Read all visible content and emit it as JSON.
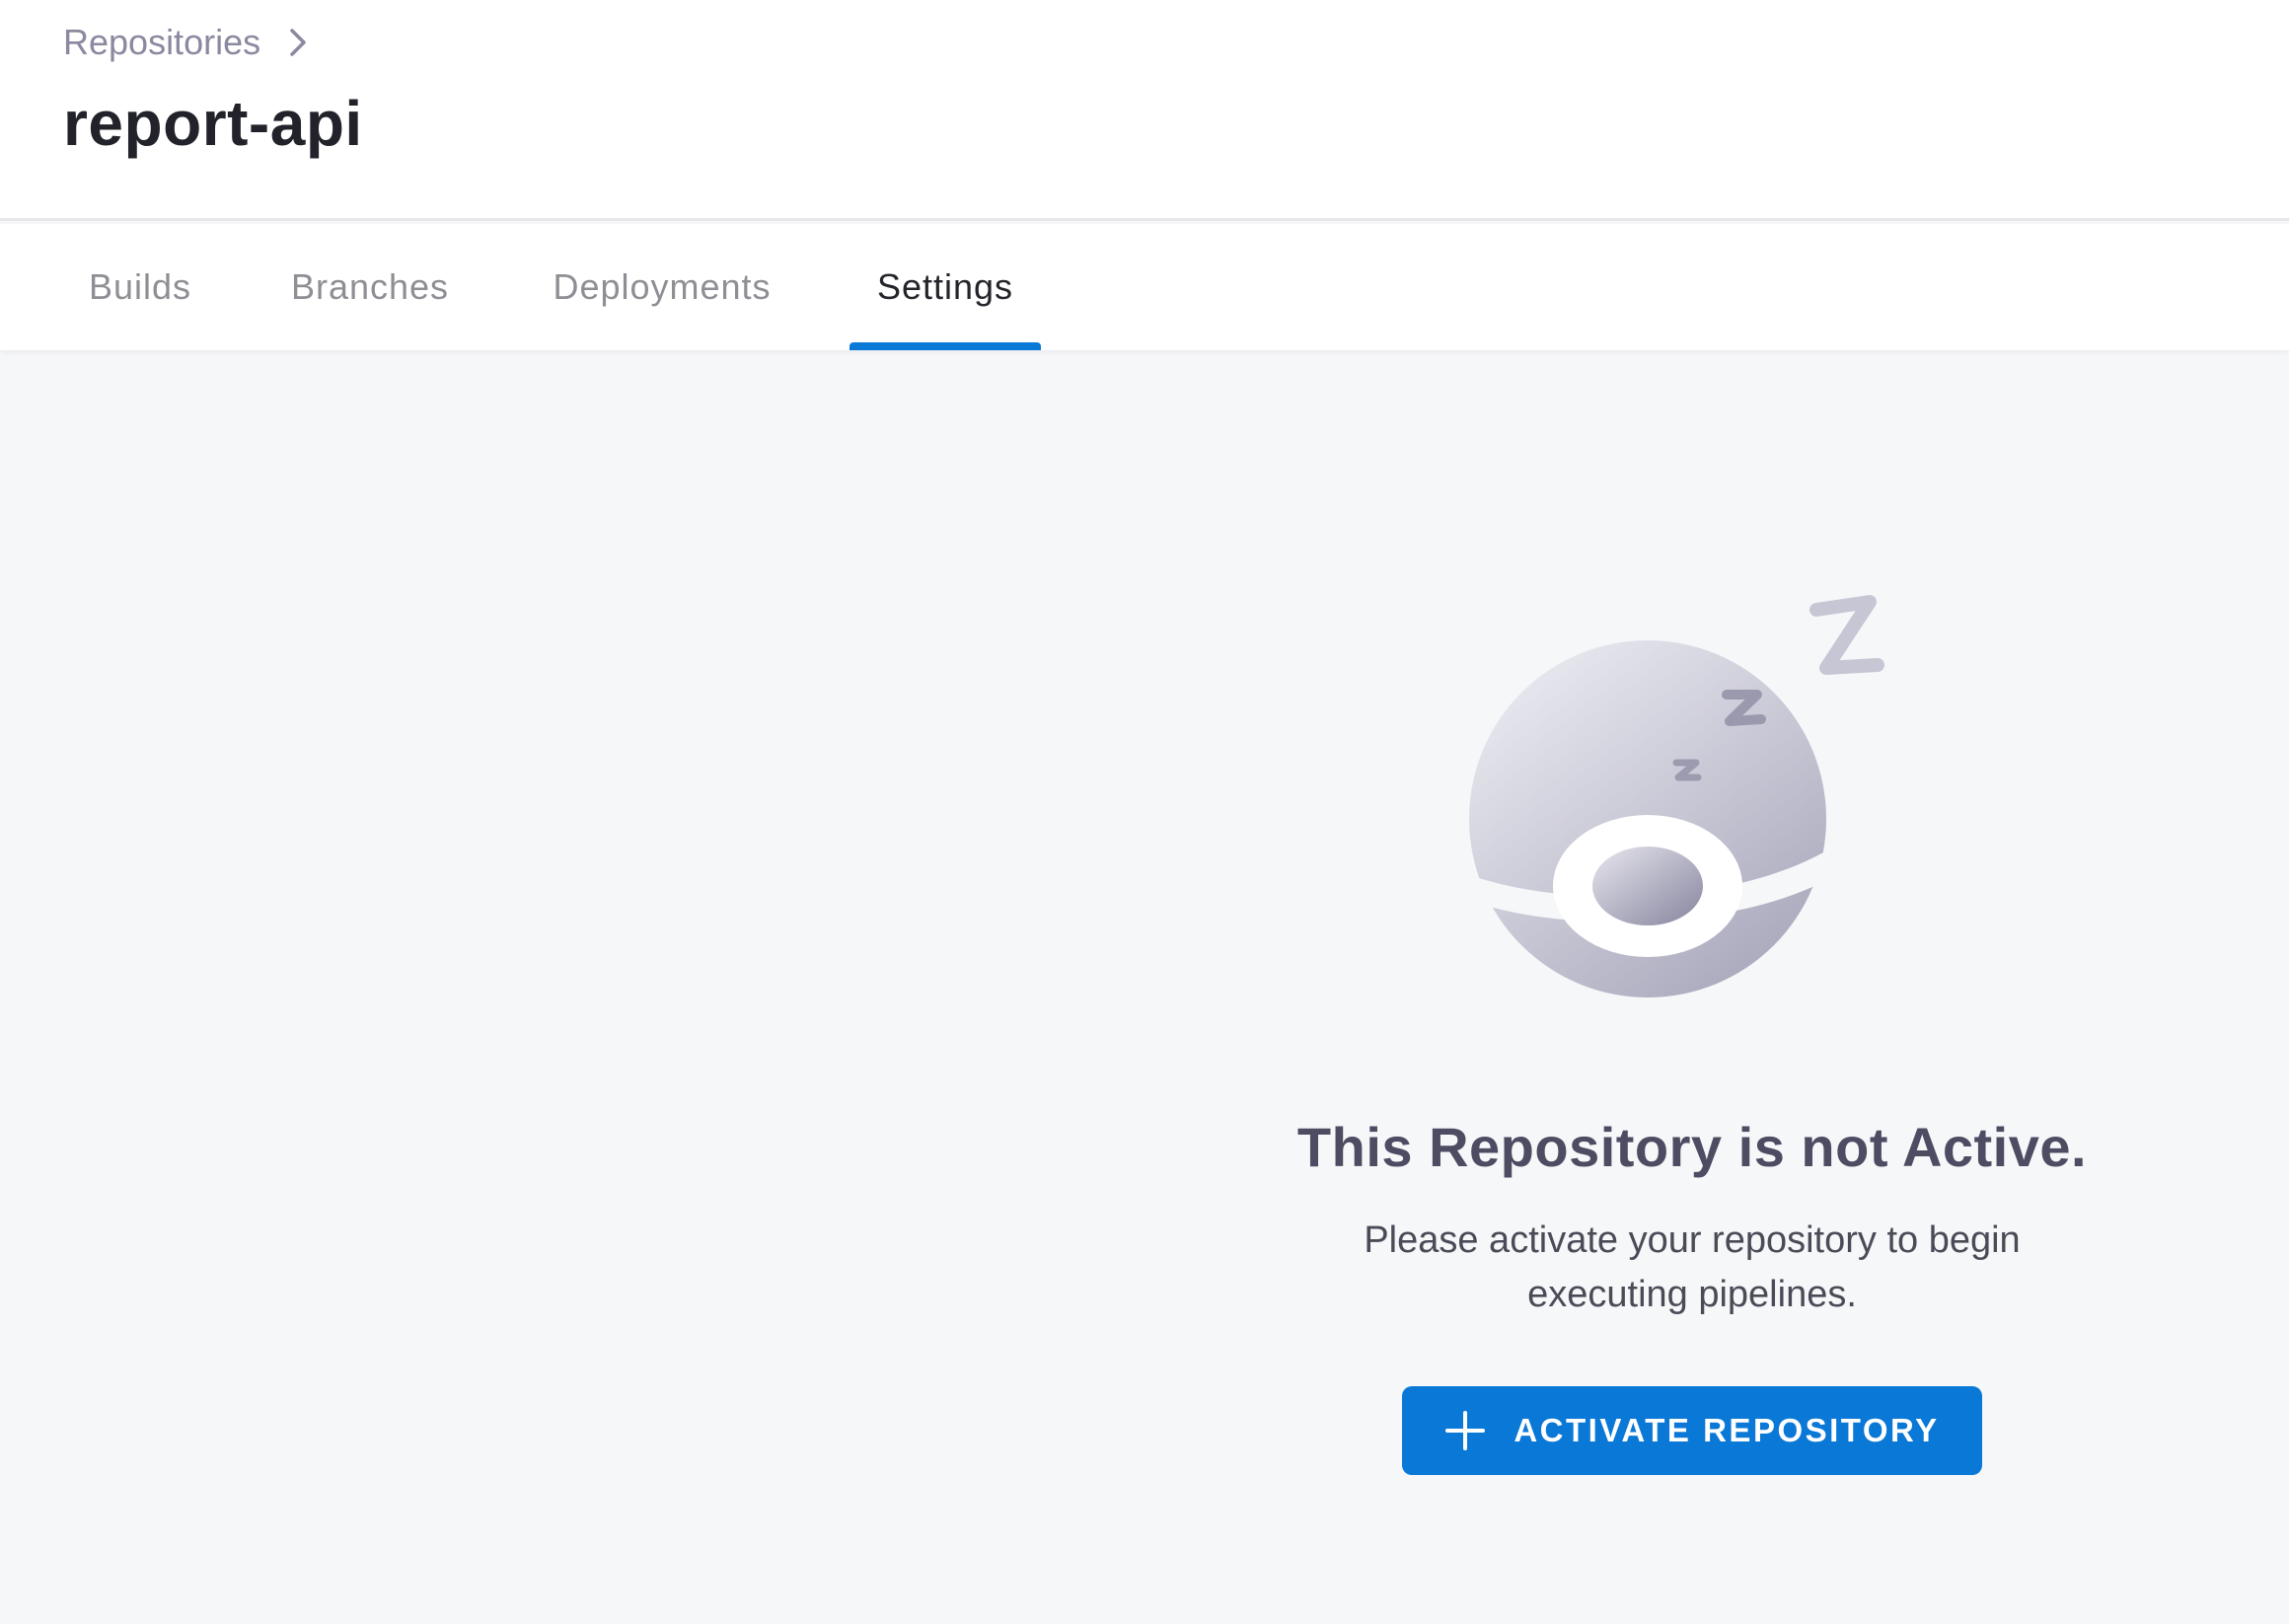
{
  "breadcrumb": {
    "parent_label": "Repositories"
  },
  "page": {
    "title": "report-api"
  },
  "tabs": [
    {
      "label": "Builds"
    },
    {
      "label": "Branches"
    },
    {
      "label": "Deployments"
    },
    {
      "label": "Settings",
      "active": true
    }
  ],
  "empty_state": {
    "illustration": "sleeping-ball-illustration",
    "title": "This Repository is not Active.",
    "description": "Please activate your repository to begin executing pipelines.",
    "button": {
      "icon": "plus-icon",
      "label": "ACTIVATE REPOSITORY"
    }
  },
  "colors": {
    "accent": "#0a78d6",
    "title_text": "#22222a",
    "muted_text": "#8e8e94",
    "background": "#f6f7f9"
  }
}
